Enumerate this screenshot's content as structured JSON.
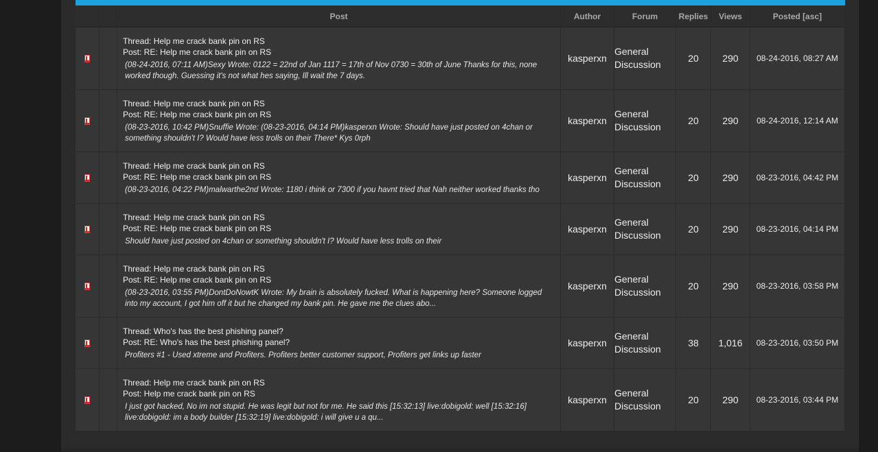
{
  "header": {
    "post": "Post",
    "author": "Author",
    "forum": "Forum",
    "replies": "Replies",
    "views": "Views",
    "posted": "Posted [asc]"
  },
  "accent_color": "#1ea2dc",
  "rows": [
    {
      "icon": "post-doc-icon",
      "thread": "Thread: Help me crack bank pin on RS",
      "post": "Post: RE: Help me crack bank pin on RS",
      "excerpt": "(08-24-2016, 07:11 AM)Sexy Wrote: 0122 = 22nd of Jan 1117 = 17th of Nov 0730 = 30th of June Thanks for this, none worked though. Guessing it's not what hes saying, Ill wait the 7 days.",
      "author": "kasperxn",
      "forum": "General Discussion",
      "replies": "20",
      "views": "290",
      "posted": "08-24-2016, 08:27 AM"
    },
    {
      "icon": "post-doc-icon",
      "thread": "Thread: Help me crack bank pin on RS",
      "post": "Post: RE: Help me crack bank pin on RS",
      "excerpt": "(08-23-2016, 10:42 PM)Snuffie Wrote: (08-23-2016, 04:14 PM)kasperxn Wrote: Should have just posted on 4chan or something shouldn't I? Would have less trolls on their There* Kys   0rph",
      "author": "kasperxn",
      "forum": "General Discussion",
      "replies": "20",
      "views": "290",
      "posted": "08-24-2016, 12:14 AM"
    },
    {
      "icon": "post-doc-icon",
      "thread": "Thread: Help me crack bank pin on RS",
      "post": "Post: RE: Help me crack bank pin on RS",
      "excerpt": "(08-23-2016, 04:22 PM)malwarthe2nd Wrote: 1180 i think or 7300 if you havnt tried that Nah neither worked thanks tho",
      "author": "kasperxn",
      "forum": "General Discussion",
      "replies": "20",
      "views": "290",
      "posted": "08-23-2016, 04:42 PM"
    },
    {
      "icon": "post-doc-icon",
      "thread": "Thread: Help me crack bank pin on RS",
      "post": "Post: RE: Help me crack bank pin on RS",
      "excerpt": "Should have just posted on 4chan or something shouldn't I? Would have less trolls on their",
      "author": "kasperxn",
      "forum": "General Discussion",
      "replies": "20",
      "views": "290",
      "posted": "08-23-2016, 04:14 PM"
    },
    {
      "icon": "post-doc-icon",
      "thread": "Thread: Help me crack bank pin on RS",
      "post": "Post: RE: Help me crack bank pin on RS",
      "excerpt": "(08-23-2016, 03:55 PM)DontDoNowtK Wrote: My brain is absolutely fucked. What is happening here? Someone logged into my account, I got him off it but he changed my bank pin. He gave me the clues abo...",
      "author": "kasperxn",
      "forum": "General Discussion",
      "replies": "20",
      "views": "290",
      "posted": "08-23-2016, 03:58 PM"
    },
    {
      "icon": "post-doc-icon",
      "thread": "Thread: Who's has the best phishing panel?",
      "post": "Post: RE: Who's has the best phishing panel?",
      "excerpt": "Profiters #1 - Used xtreme and Profiters. Profiters better customer support, Profiters get links up faster",
      "author": "kasperxn",
      "forum": "General Discussion",
      "replies": "38",
      "views": "1,016",
      "posted": "08-23-2016, 03:50 PM"
    },
    {
      "icon": "post-doc-icon",
      "thread": "Thread: Help me crack bank pin on RS",
      "post": "Post: Help me crack bank pin on RS",
      "excerpt": "I just got hacked, No im not stupid. He was legit but not for me. He said this [15:32:13] live:dobigold: well [15:32:16] live:dobigold: im a body builder [15:32:19] live:dobigold: i will give u a qu...",
      "author": "kasperxn",
      "forum": "General Discussion",
      "replies": "20",
      "views": "290",
      "posted": "08-23-2016, 03:44 PM"
    }
  ]
}
